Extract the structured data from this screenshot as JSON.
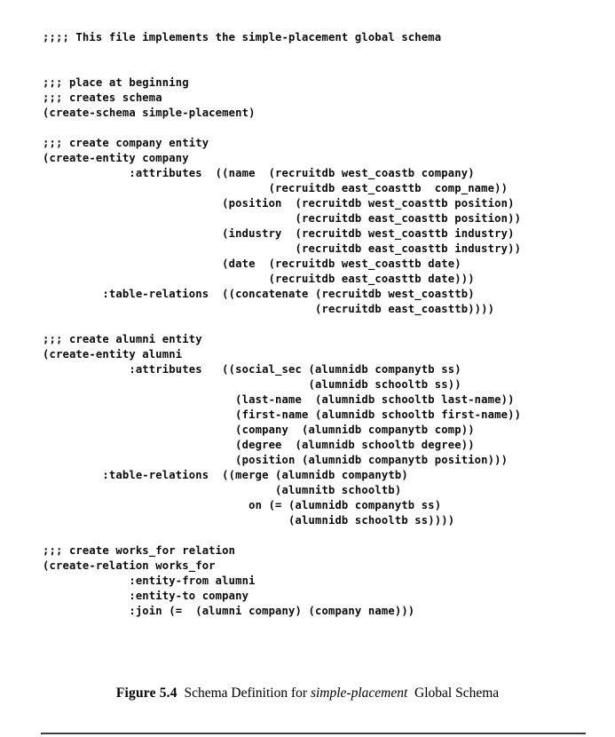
{
  "document": {
    "type": "scanned-book-page",
    "figure_number": "5.4"
  },
  "listing": {
    "lines": [
      ";;;; This file implements the simple-placement global schema",
      "",
      "",
      ";;; place at beginning",
      ";;; creates schema",
      "(create-schema simple-placement)",
      "",
      ";;; create company entity",
      "(create-entity company",
      "             :attributes  ((name  (recruitdb west_coastb company)",
      "                                  (recruitdb east_coasttb  comp_name))",
      "                           (position  (recruitdb west_coasttb position)",
      "                                      (recruitdb east_coasttb position))",
      "                           (industry  (recruitdb west_coasttb industry)",
      "                                      (recruitdb east_coasttb industry))",
      "                           (date  (recruitdb west_coasttb date)",
      "                                  (recruitdb east_coasttb date)))",
      "         :table-relations  ((concatenate (recruitdb west_coasttb)",
      "                                         (recruitdb east_coasttb))))",
      "",
      ";;; create alumni entity",
      "(create-entity alumni",
      "             :attributes   ((social_sec (alumnidb companytb ss)",
      "                                        (alumnidb schooltb ss))",
      "                             (last-name  (alumnidb schooltb last-name))",
      "                             (first-name (alumnidb schooltb first-name))",
      "                             (company  (alumnidb companytb comp))",
      "                             (degree  (alumnidb schooltb degree))",
      "                             (position (alumnidb companytb position)))",
      "         :table-relations  ((merge (alumnidb companytb)",
      "                                   (alumnitb schooltb)",
      "                               on (= (alumnidb companytb ss)",
      "                                     (alumnidb schooltb ss))))",
      "",
      ";;; create works_for relation",
      "(create-relation works_for",
      "             :entity-from alumni",
      "             :entity-to company",
      "             :join (=  (alumni company) (company name)))"
    ]
  },
  "caption": {
    "figure_label": "Figure 5.4",
    "text_before": "Schema Definition for",
    "emphasis": "simple-placement",
    "text_after": "Global Schema"
  }
}
